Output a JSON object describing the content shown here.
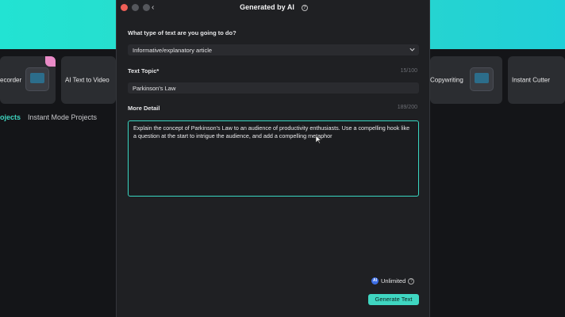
{
  "background": {
    "cards": [
      {
        "label": "ecorder"
      },
      {
        "label": "AI Text to Video"
      },
      {
        "label": "Copywriting"
      },
      {
        "label": "Instant Cutter"
      }
    ],
    "tabs": [
      {
        "label": "ojects"
      },
      {
        "label": "Instant Mode Projects"
      }
    ]
  },
  "dialog": {
    "title": "Generated by AI",
    "back_icon": "chevron-left-icon",
    "help_icon": "question-circle-icon",
    "type_question": "What type of text are you going to do?",
    "type_value": "Informative/explanatory article",
    "topic_label": "Text Topic*",
    "topic_counter": "15/100",
    "topic_value": "Parkinson's Law",
    "detail_label": "More Detail",
    "detail_counter": "189/200",
    "detail_value": "Explain the concept of Parkinson's Law to an audience of productivity enthusiasts. Use a compelling hook like a question at the start to intrigue the audience, and add a compelling metaphor",
    "credits_badge": "AI",
    "credits_label": "Unlimited",
    "generate_label": "Generate Text"
  },
  "colors": {
    "accent": "#3fd6c1",
    "banner": "#22e3d3",
    "dialog_bg": "#1f2023",
    "field_bg": "#2a2b2f"
  }
}
